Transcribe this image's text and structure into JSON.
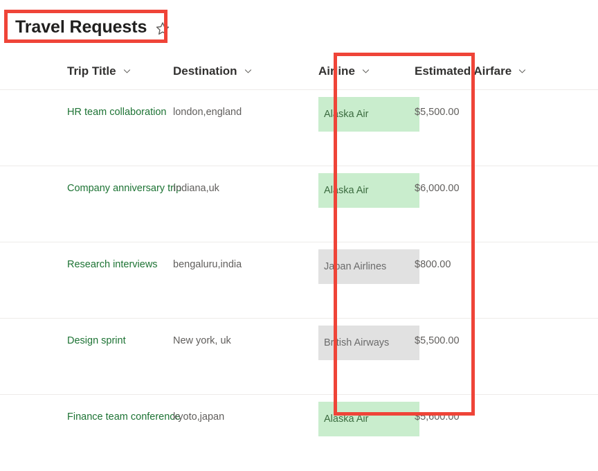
{
  "header": {
    "list_title": "Travel Requests",
    "favorite_icon": "star-icon"
  },
  "table": {
    "columns": [
      {
        "label": "Trip Title",
        "sort_icon": "chevron-down-icon"
      },
      {
        "label": "Destination",
        "sort_icon": "chevron-down-icon"
      },
      {
        "label": "Airline",
        "sort_icon": "chevron-down-icon"
      },
      {
        "label": "Estimated Airfare",
        "sort_icon": "chevron-down-icon"
      }
    ],
    "rows": [
      {
        "trip_title": "HR team collaboration",
        "destination": "london,england",
        "airline": "Alaska Air",
        "airline_style": "green",
        "estimated_airfare": "$5,500.00"
      },
      {
        "trip_title": "Company anniversary trip",
        "destination": "Indiana,uk",
        "airline": "Alaska Air",
        "airline_style": "green",
        "estimated_airfare": "$6,000.00"
      },
      {
        "trip_title": "Research interviews",
        "destination": "bengaluru,india",
        "airline": "Japan Airlines",
        "airline_style": "grey",
        "estimated_airfare": "$800.00"
      },
      {
        "trip_title": "Design sprint",
        "destination": "New york, uk",
        "airline": "British Airways",
        "airline_style": "grey",
        "estimated_airfare": "$5,500.00"
      },
      {
        "trip_title": "Finance team conference",
        "destination": "kyoto,japan",
        "airline": "Alaska Air",
        "airline_style": "green",
        "estimated_airfare": "$5,600.00"
      }
    ]
  },
  "annotations": {
    "highlight_color": "#ef4438",
    "boxes": [
      {
        "target": "list-title"
      },
      {
        "target": "airline-column"
      }
    ]
  },
  "colors": {
    "link_green": "#1d7334",
    "pill_green_bg": "#c9edcd",
    "pill_green_text": "#3b6b3f",
    "pill_grey_bg": "#e1e1e1",
    "pill_grey_text": "#6b6b6b",
    "annotation_red": "#ef4438"
  }
}
